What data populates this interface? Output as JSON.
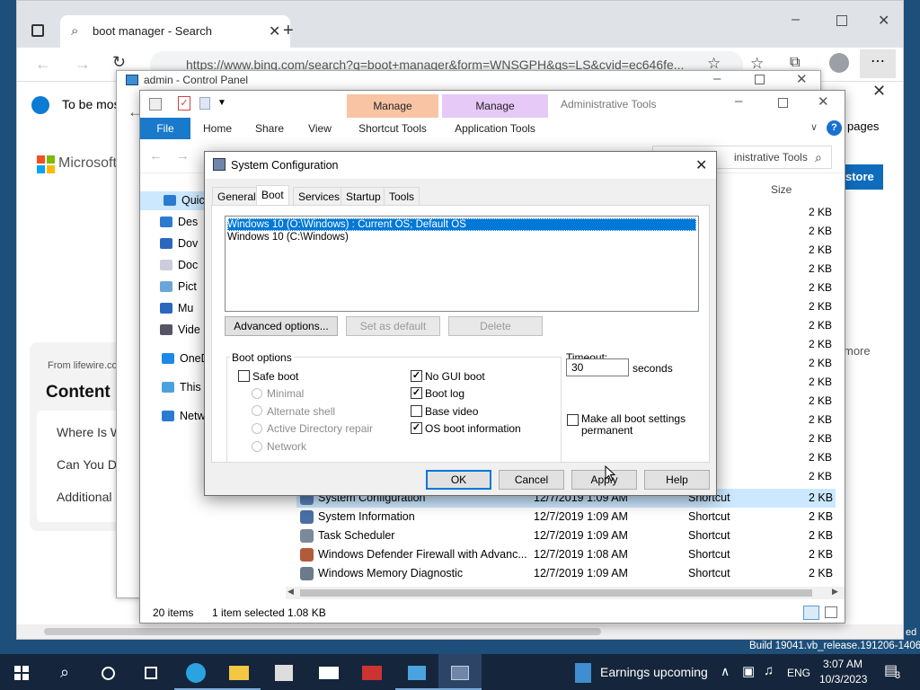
{
  "browser": {
    "tab_title": "boot manager - Search",
    "url": "https://www.bing.com/search?q=boot+manager&form=WNSGPH&qs=LS&cvid=ec646fe...",
    "page_text_left": "To be mos",
    "brand": "Microsoft",
    "source": "From lifewire.co",
    "content_heading": "Content",
    "content_items": [
      "Where Is W",
      "Can You Di",
      "Additional"
    ],
    "pages_text": "pages",
    "store_button": "store",
    "more_text": "more",
    "version_text": "sion",
    "version_text2": "ed"
  },
  "control_panel": {
    "title": "admin - Control Panel"
  },
  "explorer": {
    "title": "Administrative Tools",
    "ribbon_tabs": [
      "File",
      "Home",
      "Share",
      "View"
    ],
    "context_groups": [
      {
        "header": "Manage",
        "tab": "Shortcut Tools"
      },
      {
        "header": "Manage",
        "tab": "Application Tools"
      }
    ],
    "search_placeholder": "Search Administrative Tools",
    "search_visible": "inistrative Tools",
    "column_size": "Size",
    "nav_items": [
      "Quic",
      "Des",
      "Dov",
      "Doc",
      "Pict",
      "Mu",
      "Vide",
      "OneD",
      "This P",
      "Netw"
    ],
    "size_values": [
      "2 KB",
      "2 KB",
      "2 KB",
      "2 KB",
      "2 KB",
      "2 KB",
      "2 KB",
      "2 KB",
      "2 KB",
      "2 KB",
      "2 KB",
      "2 KB",
      "2 KB",
      "2 KB",
      "2 KB"
    ],
    "files": [
      {
        "name": "System Configuration",
        "date": "12/7/2019 1:09 AM",
        "type": "Shortcut",
        "size": "2 KB"
      },
      {
        "name": "System Information",
        "date": "12/7/2019 1:09 AM",
        "type": "Shortcut",
        "size": "2 KB"
      },
      {
        "name": "Task Scheduler",
        "date": "12/7/2019 1:09 AM",
        "type": "Shortcut",
        "size": "2 KB"
      },
      {
        "name": "Windows Defender Firewall with Advanc...",
        "date": "12/7/2019 1:08 AM",
        "type": "Shortcut",
        "size": "2 KB"
      },
      {
        "name": "Windows Memory Diagnostic",
        "date": "12/7/2019 1:09 AM",
        "type": "Shortcut",
        "size": "2 KB"
      }
    ],
    "status_items": "20 items",
    "status_selected": "1 item selected",
    "status_size": "1.08 KB"
  },
  "dialog": {
    "title": "System Configuration",
    "tabs": [
      "General",
      "Boot",
      "Services",
      "Startup",
      "Tools"
    ],
    "boot_entries": [
      "Windows 10 (O:\\Windows) : Current OS; Default OS",
      "Windows 10 (C:\\Windows)"
    ],
    "btn_advanced": "Advanced options...",
    "btn_set_default": "Set as default",
    "btn_delete": "Delete",
    "boot_options_label": "Boot options",
    "safe_boot": "Safe boot",
    "minimal": "Minimal",
    "alternate_shell": "Alternate shell",
    "ad_repair": "Active Directory repair",
    "network": "Network",
    "no_gui_boot": "No GUI boot",
    "boot_log": "Boot log",
    "base_video": "Base video",
    "os_boot_info": "OS boot information",
    "timeout_label": "Timeout:",
    "timeout_value": "30",
    "seconds": "seconds",
    "make_permanent": "Make all boot settings permanent",
    "btn_ok": "OK",
    "btn_cancel": "Cancel",
    "btn_apply": "Apply",
    "btn_help": "Help",
    "checked_mark": "✓"
  },
  "desktop": {
    "build_text": "Build 19041.vb_release.191206-1406"
  },
  "taskbar": {
    "news": "Earnings upcoming",
    "language": "ENG",
    "time": "3:07 AM",
    "date": "10/3/2023",
    "notification_count": "3"
  }
}
